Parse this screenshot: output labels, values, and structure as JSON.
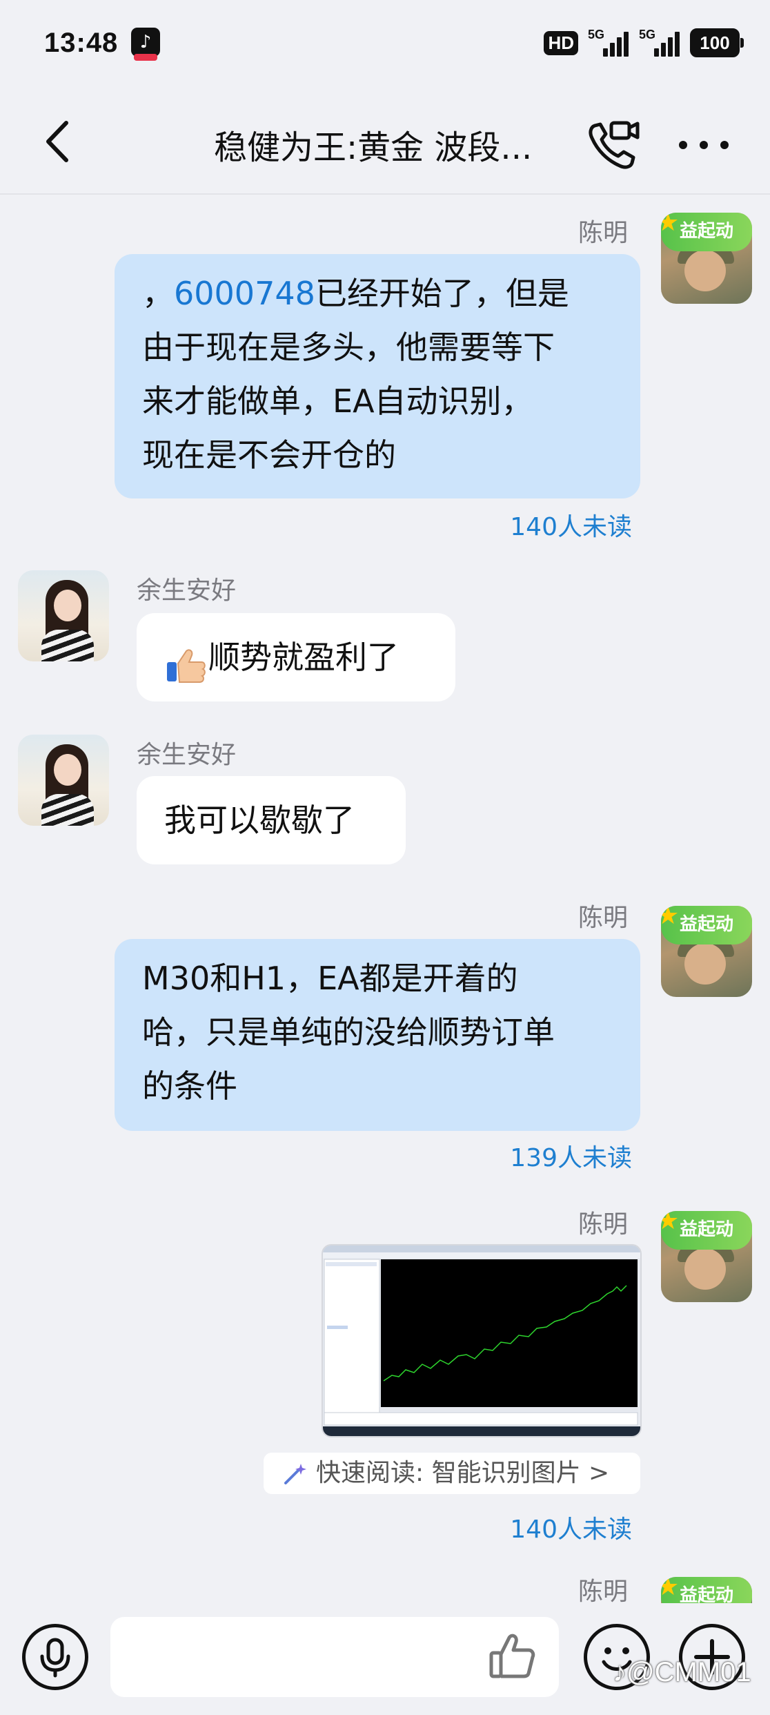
{
  "status_bar": {
    "time": "13:48",
    "hd": "HD",
    "sim1_label": "5G",
    "sim2_label": "5G",
    "battery": "100"
  },
  "header": {
    "title": "稳健为王:黄金 波段..."
  },
  "messages": [
    {
      "sender": "陈明",
      "side": "out",
      "prefix": "，",
      "link": "6000748",
      "text": "已经开始了，但是由于现在是多头，他需要等下来才能做单，EA自动识别，现在是不会开仓的",
      "line1": "已经开始了，但是",
      "line2": "由于现在是多头，他需要等下",
      "line3": "来才能做单，EA自动识别，",
      "line4": "现在是不会开仓的",
      "unread": "140人未读"
    },
    {
      "sender": "余生安好",
      "side": "in",
      "emoji": "thumbs-up",
      "text": "顺势就盈利了"
    },
    {
      "sender": "余生安好",
      "side": "in",
      "text": "我可以歇歇了"
    },
    {
      "sender": "陈明",
      "side": "out",
      "text": "M30和H1，EA都是开着的哈，只是单纯的没给顺势订单的条件",
      "line1": "M30和H1，EA都是开着的",
      "line2": "哈，只是单纯的没给顺势订单",
      "line3": "的条件",
      "unread": "139人未读"
    },
    {
      "sender": "陈明",
      "side": "out",
      "type": "image",
      "quick_read": "快速阅读: 智能识别图片 >",
      "unread": "140人未读"
    },
    {
      "sender": "陈明",
      "side": "out"
    }
  ],
  "avatar_badge": "益起动",
  "watermark": "@CMM01",
  "colors": {
    "background": "#f0f1f5",
    "outgoing_bubble": "#cde4fb",
    "incoming_bubble": "#ffffff",
    "link": "#1877d2",
    "unread": "#1e7fd0",
    "name": "#7a7a80"
  }
}
